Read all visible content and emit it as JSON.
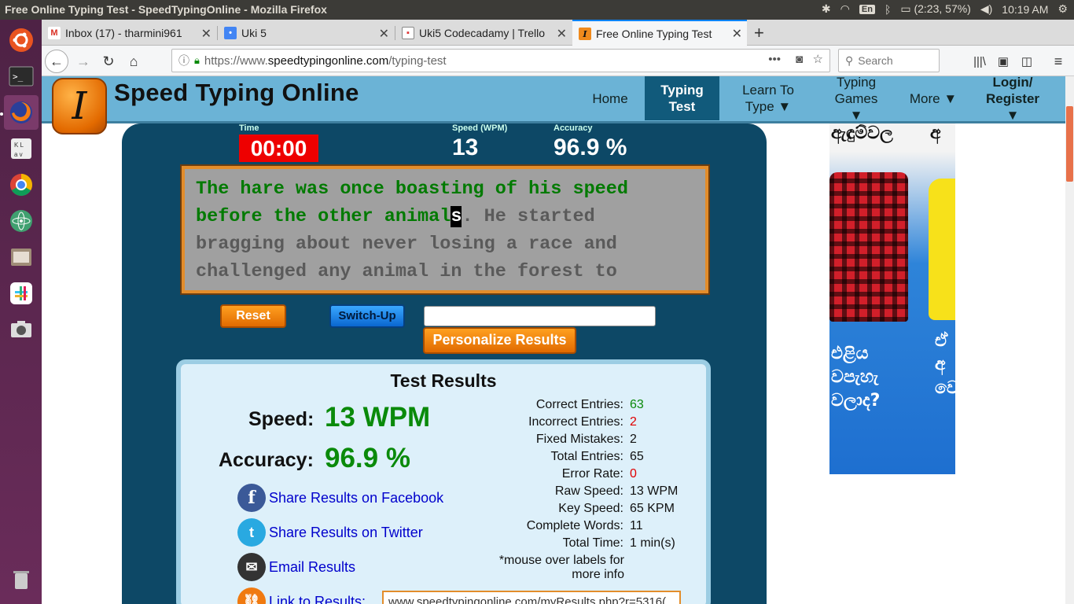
{
  "os": {
    "window_title": "Free Online Typing Test - SpeedTypingOnline - Mozilla Firefox",
    "keyboard_lang": "En",
    "battery": "(2:23, 57%)",
    "clock": "10:19 AM"
  },
  "tabs": [
    {
      "label": "Inbox (17) - tharmini961",
      "icon": "gmail-icon"
    },
    {
      "label": "Uki 5",
      "icon": "classroom-icon"
    },
    {
      "label": "Uki5 Codecadamy | Trello",
      "icon": "trello-icon"
    },
    {
      "label": "Free Online Typing Test",
      "icon": "speedtyping-icon",
      "active": true
    }
  ],
  "url": {
    "protocol": "https://www.",
    "domain": "speedtypingonline.com",
    "path": "/typing-test"
  },
  "search": {
    "placeholder": "Search"
  },
  "site": {
    "title": "Speed Typing Online",
    "logo_letter": "I",
    "nav": [
      {
        "label": "Home"
      },
      {
        "label": "Typing Test",
        "active": true
      },
      {
        "label": "Learn To Type ▼"
      },
      {
        "label": "Typing Games ▼"
      },
      {
        "label": "More ▼"
      },
      {
        "label": "Login/ Register ▼"
      }
    ]
  },
  "stats": {
    "time_label": "Time",
    "time_value": "00:00",
    "speed_label": "Speed (WPM)",
    "speed_value": "13",
    "accuracy_label": "Accuracy",
    "accuracy_value": "96.9 %"
  },
  "passage": {
    "typed": "The hare was once boasting of his speed before the other animal",
    "cursor": "s",
    "remaining": ". He started bragging about never losing a race and challenged any animal in the forest to"
  },
  "controls": {
    "reset": "Reset",
    "switch_up": "Switch-Up",
    "personalize": "Personalize Results"
  },
  "results": {
    "title": "Test Results",
    "speed_label": "Speed:",
    "speed_value": "13 WPM",
    "accuracy_label": "Accuracy:",
    "accuracy_value": "96.9 %",
    "share_facebook": "Share Results on Facebook",
    "share_twitter": "Share Results on Twitter",
    "email": "Email Results",
    "link_label": "Link to Results:",
    "link_value": "www.speedtypingonline.com/myResults.php?r=5316(",
    "details": [
      {
        "label": "Correct Entries:",
        "value": "63",
        "color": "#0a8a0a"
      },
      {
        "label": "Incorrect Entries:",
        "value": "2",
        "color": "#e00000"
      },
      {
        "label": "Fixed Mistakes:",
        "value": "2",
        "color": "#111111"
      },
      {
        "label": "Total Entries:",
        "value": "65",
        "color": "#111111"
      },
      {
        "label": "Error Rate:",
        "value": "0",
        "color": "#e00000"
      },
      {
        "label": "Raw Speed:",
        "value": "13 WPM",
        "color": "#111111"
      },
      {
        "label": "Key Speed:",
        "value": "65 KPM",
        "color": "#111111"
      },
      {
        "label": "Complete Words:",
        "value": "11",
        "color": "#111111"
      },
      {
        "label": "Total Time:",
        "value": "1 min(s)",
        "color": "#111111"
      }
    ],
    "note_line1": "*mouse over labels for",
    "note_line2": "more info"
  },
  "ad": {
    "top_text_left": "ඇඳුම්වල",
    "top_text_right": "අ",
    "bottom_text": "එළිය\nවපැහැ\nවලාද?",
    "bottom_right": "ඒ\nඅ\nවෙ"
  },
  "colors": {
    "site_header": "#6bb3d6",
    "panel": "#0d4866",
    "typed_text": "#007a00",
    "timer_bg": "#ee0000",
    "accent_orange": "#e38d2b"
  }
}
